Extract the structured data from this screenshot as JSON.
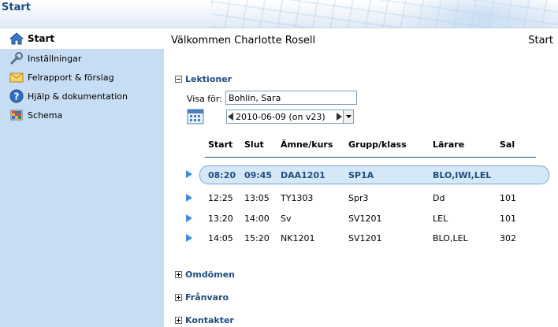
{
  "header": {
    "title": "Start"
  },
  "sidebar": {
    "items": [
      {
        "label": "Start",
        "icon": "home-icon"
      },
      {
        "label": "Inställningar",
        "icon": "wrench-icon"
      },
      {
        "label": "Felrapport & förslag",
        "icon": "envelope-icon"
      },
      {
        "label": "Hjälp & dokumentation",
        "icon": "help-icon"
      },
      {
        "label": "Schema",
        "icon": "schedule-grid-icon"
      }
    ]
  },
  "main": {
    "welcome": "Välkommen Charlotte Rosell",
    "breadcrumb": "Start",
    "lektioner": {
      "title": "Lektioner",
      "visa_label": "Visa för:",
      "visa_value": "Bohlin, Sara",
      "date_value": "2010-06-09 (on v23)",
      "columns": [
        "Start",
        "Slut",
        "Ämne/kurs",
        "Grupp/klass",
        "Lärare",
        "Sal"
      ],
      "rows": [
        {
          "start": "08:20",
          "slut": "09:45",
          "amne": "DAA1201",
          "grupp": "SP1A",
          "larare": "BLO,IWI,LEL",
          "sal": ""
        },
        {
          "start": "12:25",
          "slut": "13:05",
          "amne": "TY1303",
          "grupp": "Spr3",
          "larare": "Dd",
          "sal": "101"
        },
        {
          "start": "13:20",
          "slut": "14:00",
          "amne": "Sv",
          "grupp": "SV1201",
          "larare": "LEL",
          "sal": "101"
        },
        {
          "start": "14:05",
          "slut": "15:20",
          "amne": "NK1201",
          "grupp": "SV1201",
          "larare": "BLO,LEL",
          "sal": "302"
        }
      ]
    },
    "sections": [
      {
        "title": "Omdömen"
      },
      {
        "title": "Frånvaro"
      },
      {
        "title": "Kontakter"
      }
    ]
  },
  "colors": {
    "sidebar_bg": "#c6ddf3",
    "accent": "#1e4d84",
    "highlight_row": "#d5e8f7"
  }
}
